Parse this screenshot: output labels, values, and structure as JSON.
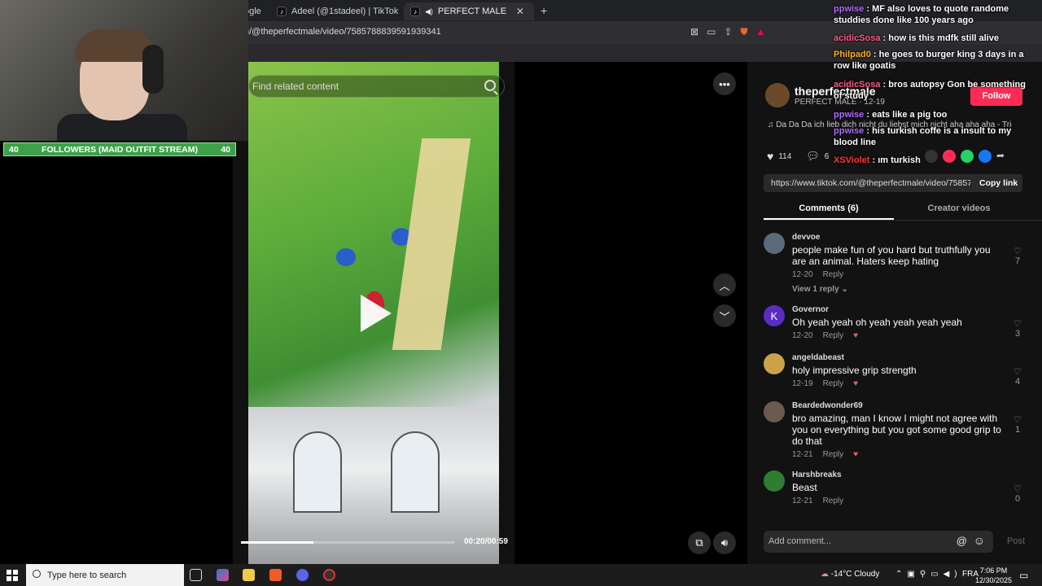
{
  "browser": {
    "tabs": [
      {
        "label": "ogle"
      },
      {
        "label": "Adeel (@1stadeel) | TikTok"
      },
      {
        "label": "PERFECT MALE (@theperfect"
      }
    ],
    "url": "n/@theperfectmale/video/7585788839591939341"
  },
  "stream": {
    "followers_goal": {
      "left": "40",
      "label": "FOLLOWERS (MAID OUTFIT STREAM)",
      "right": "40"
    },
    "chat": [
      {
        "name": "ppwise",
        "text": "MF also loves to quote randome studdies done like 100 years ago",
        "color": "#b36cff"
      },
      {
        "name": "acidicSosa",
        "text": "how is this mdfk still alive",
        "color": "#ff5c8a"
      },
      {
        "name": "Philpad0",
        "text": "he goes to burger king 3 days in a row like goatis",
        "color": "#ffb020"
      },
      {
        "name": "acidicSosa",
        "text": "bros autopsy Gon be something of study",
        "color": "#ff5c8a"
      },
      {
        "name": "ppwise",
        "text": "eats like a pig too",
        "color": "#b36cff"
      },
      {
        "name": "ppwise",
        "text": "his turkish coffe is a insult to my blood line",
        "color": "#b36cff"
      },
      {
        "name": "XSViolet",
        "text": "ım turkish",
        "color": "#ff3b3b"
      }
    ]
  },
  "video": {
    "search_placeholder": "Find related content",
    "time": "00:20/00:59",
    "progress": 0.34
  },
  "post": {
    "author": "theperfectmale",
    "display_name": "PERFECT MALE",
    "date": "12-19",
    "follow_label": "Follow",
    "music": "♫  Da Da Da ich lieb dich nicht du liebst mich nicht aha aha aha - Trio",
    "likes": "114",
    "comments_count": "6",
    "link": "https://www.tiktok.com/@theperfectmale/video/75857...",
    "copy_label": "Copy link",
    "tab_comments": "Comments (6)",
    "tab_creator": "Creator videos",
    "view_replies": "View 1 reply",
    "reply_label": "Reply",
    "add_comment": "Add comment...",
    "post_label": "Post"
  },
  "comments": [
    {
      "user": "devvoe",
      "text": "people make fun of you hard but truthfully you are an animal. Haters keep hating",
      "date": "12-20",
      "likes": "7",
      "avatar_color": "#5a6a7a"
    },
    {
      "user": "Governor",
      "text": "Oh yeah yeah oh yeah yeah yeah yeah",
      "date": "12-20",
      "likes": "3",
      "avatar_color": "#5b2bc4",
      "avatar_letter": "K"
    },
    {
      "user": "angeldabeast",
      "text": "holy impressive grip strength",
      "date": "12-19",
      "likes": "4",
      "avatar_color": "#c9a24a"
    },
    {
      "user": "Beardedwonder69",
      "text": "bro amazing, man I know I might not agree with you on everything but you got some good grip to do that",
      "date": "12-21",
      "likes": "1",
      "avatar_color": "#6a5a50"
    },
    {
      "user": "Harshbreaks",
      "text": "Beast",
      "date": "12-21",
      "likes": "0",
      "avatar_color": "#2e7d32"
    }
  ],
  "taskbar": {
    "search_placeholder": "Type here to search",
    "weather": "-14°C  Cloudy",
    "lang": "FRA",
    "time": "7:06 PM",
    "date": "12/30/2025"
  }
}
